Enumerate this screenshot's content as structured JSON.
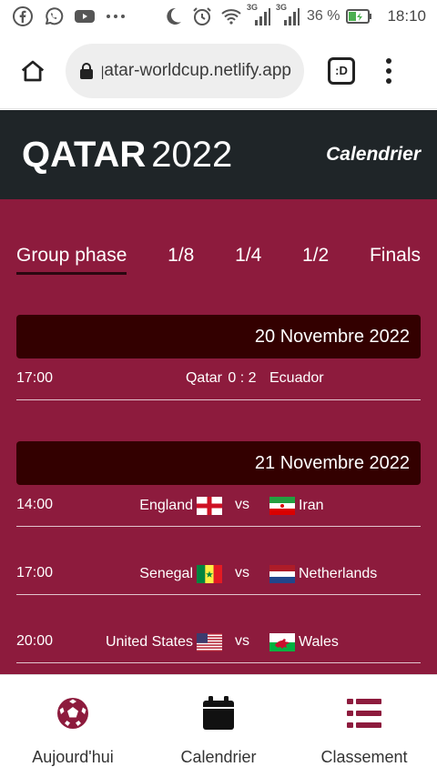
{
  "status_bar": {
    "icons": [
      "facebook-icon",
      "whatsapp-icon",
      "youtube-icon",
      "more-dots-icon",
      "moon-icon",
      "alarm-icon",
      "wifi-icon",
      "signal-3g-icon",
      "signal-3g-icon",
      "battery-charging-icon"
    ],
    "network_1": "3G",
    "network_2": "3G",
    "battery": "36 %",
    "time": "18:10"
  },
  "browser": {
    "url": "qatar-worldcup.netlify.app",
    "tabs_label": ":D"
  },
  "header": {
    "brand_bold": "QATAR",
    "brand_light": "2022",
    "link": "Calendrier"
  },
  "phase_tabs": [
    {
      "label": "Group phase",
      "active": true
    },
    {
      "label": "1/8",
      "active": false
    },
    {
      "label": "1/4",
      "active": false
    },
    {
      "label": "1/2",
      "active": false
    },
    {
      "label": "Finals",
      "active": false
    }
  ],
  "days": [
    {
      "date": "20 Novembre 2022",
      "matches": [
        {
          "time": "17:00",
          "home": "Qatar",
          "mid": "0 : 2",
          "away": "Ecuador"
        }
      ]
    },
    {
      "date": "21 Novembre 2022",
      "matches": [
        {
          "time": "14:00",
          "home": "England",
          "home_flag": "flag-england",
          "mid": "vs",
          "away": "Iran",
          "away_flag": "flag-iran"
        },
        {
          "time": "17:00",
          "home": "Senegal",
          "home_flag": "flag-senegal",
          "mid": "vs",
          "away": "Netherlands",
          "away_flag": "flag-netherlands"
        },
        {
          "time": "20:00",
          "home": "United States",
          "home_flag": "flag-usa",
          "mid": "vs",
          "away": "Wales",
          "away_flag": "flag-wales"
        }
      ]
    }
  ],
  "bottom_nav": [
    {
      "label": "Aujourd'hui",
      "icon": "soccer-ball-icon",
      "color": "#8d1b3d"
    },
    {
      "label": "Calendrier",
      "icon": "calendar-icon",
      "color": "#111111"
    },
    {
      "label": "Classement",
      "icon": "list-icon",
      "color": "#8d1b3d"
    }
  ],
  "colors": {
    "header_bg": "#1f2528",
    "main_bg": "#8d1b3d",
    "date_bar_bg": "#330000"
  }
}
